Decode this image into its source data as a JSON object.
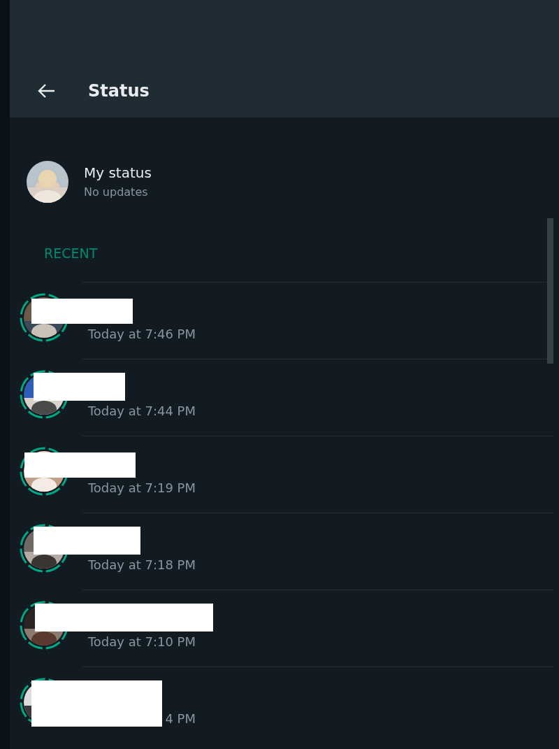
{
  "header": {
    "title": "Status"
  },
  "my_status": {
    "name": "My status",
    "subtitle": "No updates"
  },
  "section_label": "RECENT",
  "updates": [
    {
      "time": "Today at 7:46 PM"
    },
    {
      "time": "Today at 7:44 PM"
    },
    {
      "time": "Today at 7:19 PM"
    },
    {
      "time": "Today at 7:18 PM"
    },
    {
      "time": "Today at 7:10 PM"
    },
    {
      "time": "4 PM"
    }
  ]
}
